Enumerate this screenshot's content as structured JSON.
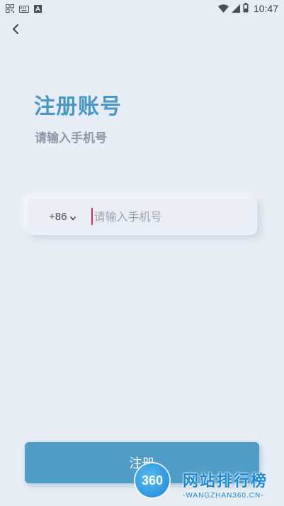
{
  "status_bar": {
    "time": "10:47",
    "left_icons": [
      "qr-code-icon",
      "keyboard-icon",
      "text-app-icon"
    ],
    "right_icons": [
      "wifi-icon",
      "signal-icon",
      "battery-icon"
    ]
  },
  "header": {
    "back_icon": "chevron-left-icon"
  },
  "page": {
    "title": "注册账号",
    "subtitle": "请输入手机号"
  },
  "phone_form": {
    "country_code": "+86",
    "country_icon": "chevron-down-icon",
    "phone_value": "",
    "phone_placeholder": "请输入手机号"
  },
  "actions": {
    "register_label": "注册"
  },
  "watermark": {
    "logo_number": "360",
    "name": "网站排行榜",
    "domain": "-WANGZHAN360.CN-"
  },
  "colors": {
    "background": "#e7edf5",
    "accent": "#4f9cc7",
    "title": "#4a97c4",
    "caret": "#d8266a"
  }
}
